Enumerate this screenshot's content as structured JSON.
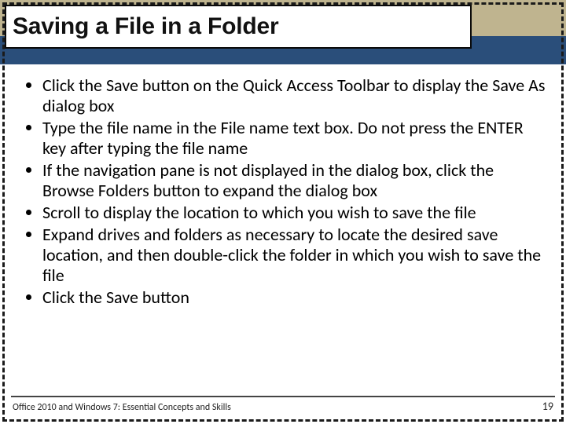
{
  "title": "Saving a File in a Folder",
  "bullets": [
    "Click the Save button on the Quick Access Toolbar to display the Save As dialog box",
    "Type the file name in the File name text box. Do not press the ENTER key after typing the file name",
    "If the navigation pane is not displayed in the dialog box, click the Browse Folders button to expand the dialog box",
    "Scroll to display the location to which you wish to save the file",
    "Expand drives and folders as necessary to locate the desired save location, and then double-click the folder in which you wish to save the file",
    "Click the Save button"
  ],
  "footer": "Office 2010 and Windows 7: Essential Concepts and Skills",
  "page_number": "19"
}
